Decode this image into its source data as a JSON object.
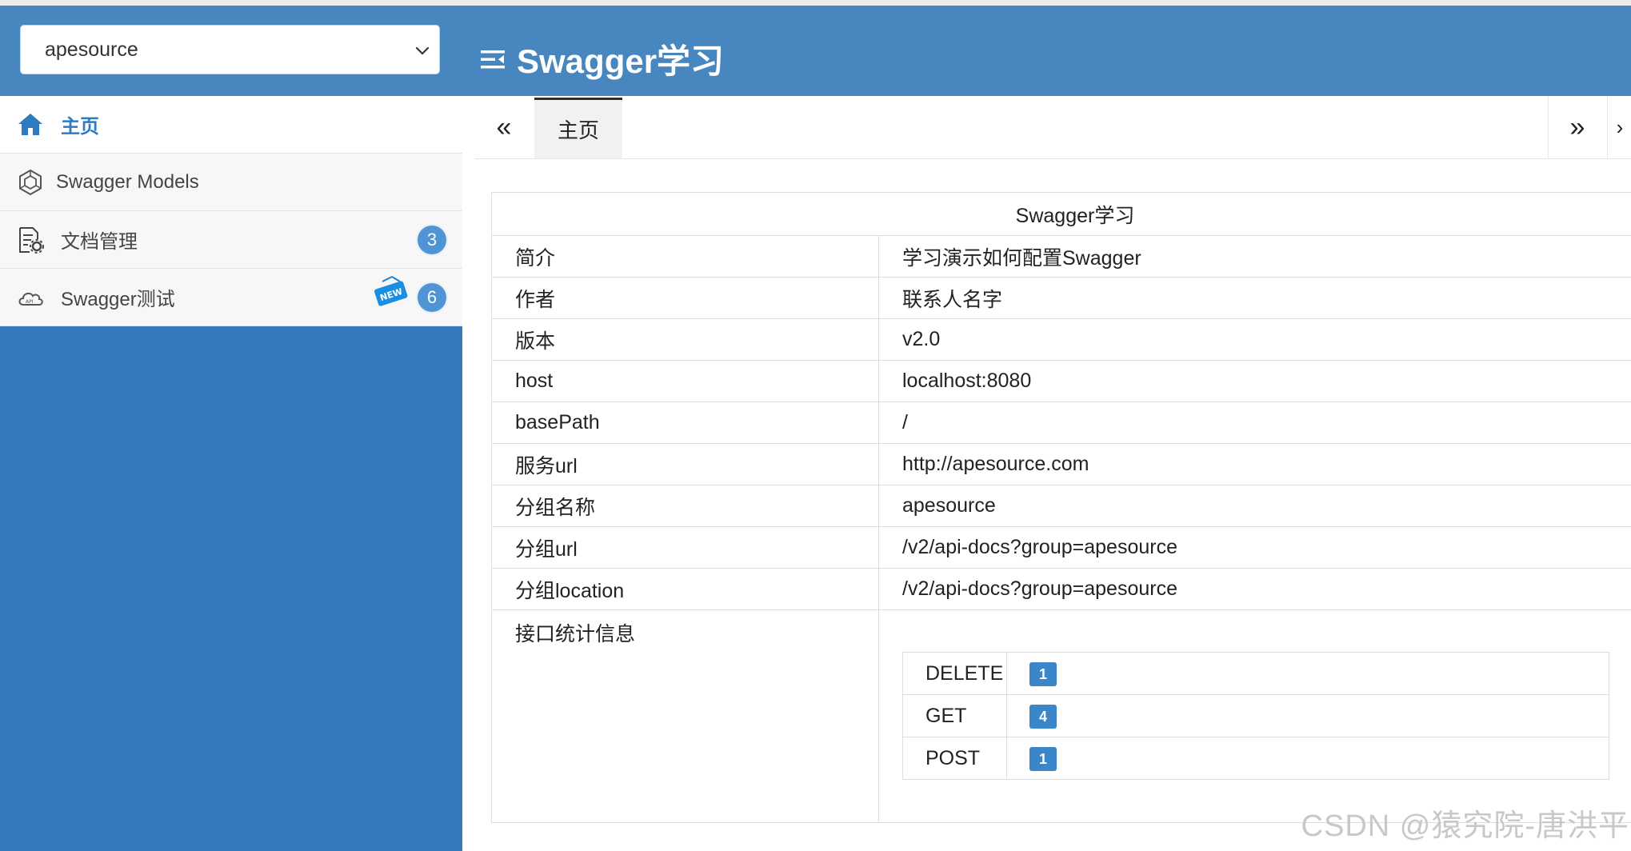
{
  "header": {
    "group_select": {
      "value": "apesource"
    },
    "title": "Swagger学习",
    "menu_icon": "menu-collapse-icon"
  },
  "sidebar": {
    "items": [
      {
        "label": "主页",
        "icon": "home-icon",
        "active": true
      },
      {
        "label": "Swagger Models",
        "icon": "models-icon"
      },
      {
        "label": "文档管理",
        "icon": "document-settings-icon",
        "badge": "3"
      },
      {
        "label": "Swagger测试",
        "icon": "api-cloud-icon",
        "badge": "6",
        "tag": "NEW"
      }
    ]
  },
  "tabs": {
    "prev_label": "«",
    "next_label": "»",
    "more_label": "›",
    "items": [
      {
        "label": "主页",
        "active": true
      }
    ]
  },
  "info": {
    "title": "Swagger学习",
    "rows": [
      {
        "key": "简介",
        "value": "学习演示如何配置Swagger"
      },
      {
        "key": "作者",
        "value": "联系人名字"
      },
      {
        "key": "版本",
        "value": "v2.0"
      },
      {
        "key": "host",
        "value": "localhost:8080"
      },
      {
        "key": "basePath",
        "value": "/"
      },
      {
        "key": "服务url",
        "value": "http://apesource.com"
      },
      {
        "key": "分组名称",
        "value": "apesource"
      },
      {
        "key": "分组url",
        "value": "/v2/api-docs?group=apesource"
      },
      {
        "key": "分组location",
        "value": "/v2/api-docs?group=apesource"
      }
    ],
    "stats_key": "接口统计信息",
    "stats": [
      {
        "method": "DELETE",
        "count": "1"
      },
      {
        "method": "GET",
        "count": "4"
      },
      {
        "method": "POST",
        "count": "1"
      }
    ]
  },
  "watermark": "CSDN @猿究院-唐洪平",
  "colors": {
    "header_bg": "#4786be",
    "sidebar_bg": "#357abd",
    "active_text": "#2f7bc2",
    "badge_bg": "#4f94d4"
  }
}
